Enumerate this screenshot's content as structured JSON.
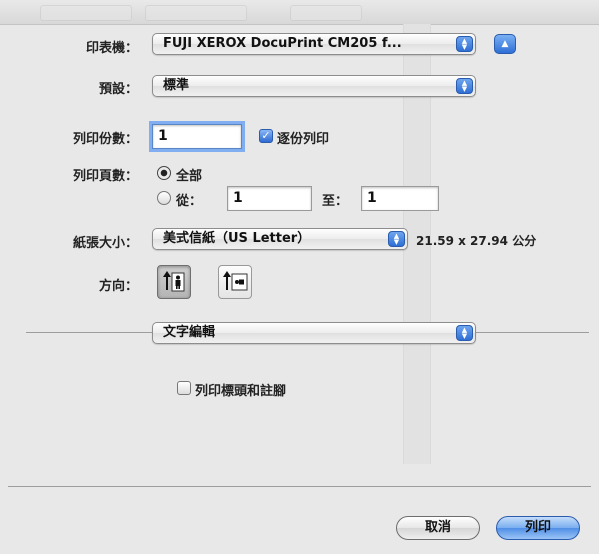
{
  "printer": {
    "label": "印表機：",
    "value": "FUJI XEROX DocuPrint CM205 f...",
    "expand_icon": "disclosure-triangle-up"
  },
  "preset": {
    "label": "預設：",
    "value": "標準"
  },
  "copies": {
    "label": "列印份數：",
    "value": "1",
    "collate_label": "逐份列印",
    "collate_checked": true
  },
  "pages": {
    "label": "列印頁數：",
    "all_label": "全部",
    "from_label": "從：",
    "from_value": "1",
    "to_label": "至：",
    "to_value": "1",
    "selected": "all"
  },
  "paper": {
    "label": "紙張大小：",
    "value": "美式信紙（US Letter）",
    "dimensions": "21.59 x 27.94 公分"
  },
  "orientation": {
    "label": "方向：",
    "selected": "portrait"
  },
  "section": {
    "value": "文字編輯"
  },
  "header_footer": {
    "label": "列印標頭和註腳",
    "checked": false
  },
  "buttons": {
    "cancel": "取消",
    "print": "列印"
  },
  "colors": {
    "accent": "#4f8fe6",
    "background": "#e8e8e8"
  }
}
